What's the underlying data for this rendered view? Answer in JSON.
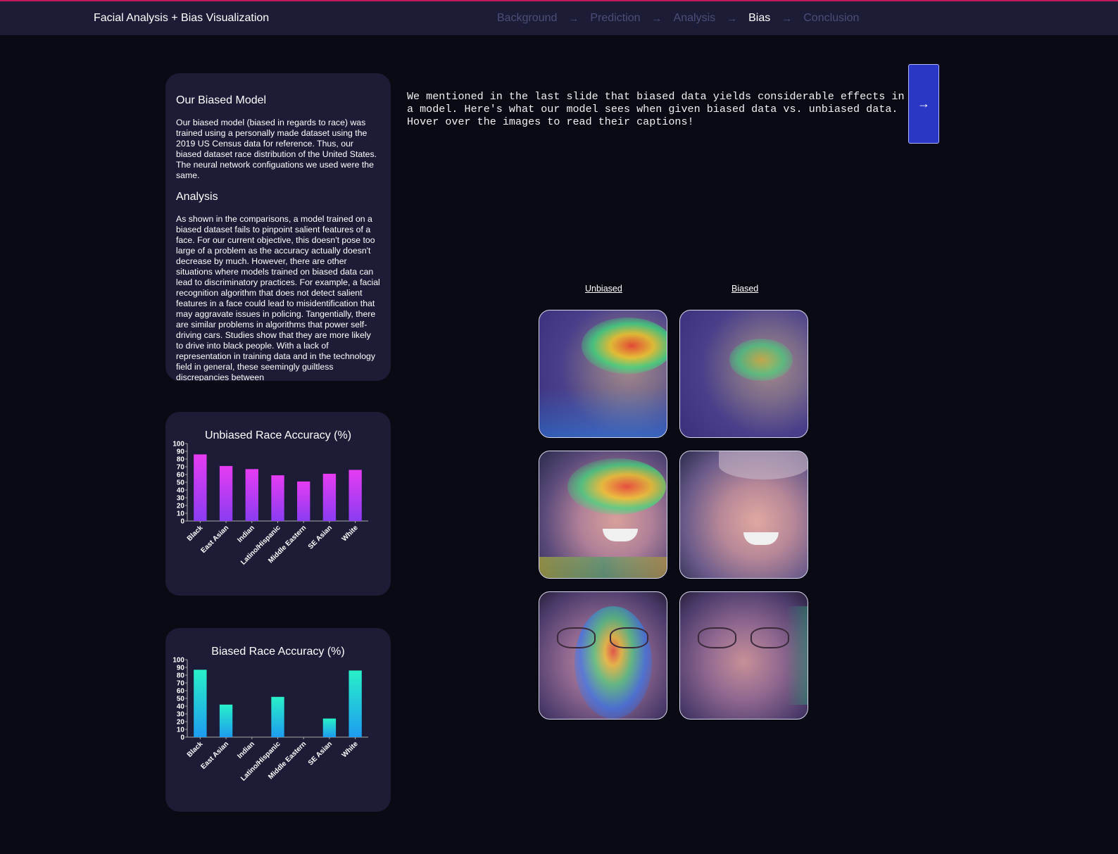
{
  "nav": {
    "brand": "Facial Analysis + Bias Visualization",
    "steps": [
      "Background",
      "Prediction",
      "Analysis",
      "Bias",
      "Conclusion"
    ],
    "arrow": "→",
    "active_step": "Bias"
  },
  "info": {
    "title": "Our Biased Model",
    "body": "Our biased model (biased in regards to race) was trained using a personally made dataset using the 2019 US Census data for reference. Thus, our biased dataset race distribution of the United States. The neural network configuations we used were the same.",
    "analysis_title": "Analysis",
    "analysis_body": "As shown in the comparisons, a model trained on a biased dataset fails to pinpoint salient features of a face. For our current objective, this doesn't pose too large of a problem as the accuracy actually doesn't decrease by much. However, there are other situations where models trained on biased data can lead to discriminatory practices. For example, a facial recognition algorithm that does not detect salient features in a face could lead to misidentification that may aggravate issues in policing. Tangentially, there are similar problems in algorithms that power self-driving cars. Studies show that they are more likely to drive into black people. With a lack of representation in training data and in the technology field in general, these seemingly guiltless discrepancies between"
  },
  "intro": {
    "text": "We mentioned in the last slide that biased data yields considerable effects in a model. Here's what our model sees when given biased data vs. unbiased data. Hover over the images to read their captions!",
    "next_label": "→"
  },
  "gallery": {
    "unbiased_label": "Unbiased",
    "biased_label": "Biased"
  },
  "chart_data": [
    {
      "type": "bar",
      "title": "Unbiased Race Accuracy (%)",
      "categories": [
        "Black",
        "East Asian",
        "Indian",
        "Latino/Hispanic",
        "Middle Eastern",
        "SE Asian",
        "White"
      ],
      "values": [
        86,
        71,
        67,
        59,
        51,
        61,
        66
      ],
      "ylim": [
        0,
        100
      ],
      "yticks": [
        0,
        10,
        20,
        30,
        40,
        50,
        60,
        70,
        80,
        90,
        100
      ],
      "color_top": "#e63cf2",
      "color_bottom": "#8a3cf2"
    },
    {
      "type": "bar",
      "title": "Biased Race Accuracy (%)",
      "categories": [
        "Black",
        "East Asian",
        "Indian",
        "Latino/Hispanic",
        "Middle Eastern",
        "SE Asian",
        "White"
      ],
      "values": [
        87,
        42,
        0,
        52,
        0,
        24,
        86
      ],
      "ylim": [
        0,
        100
      ],
      "yticks": [
        0,
        10,
        20,
        30,
        40,
        50,
        60,
        70,
        80,
        90,
        100
      ],
      "color_top": "#28f0c8",
      "color_bottom": "#1e9cf0"
    }
  ]
}
